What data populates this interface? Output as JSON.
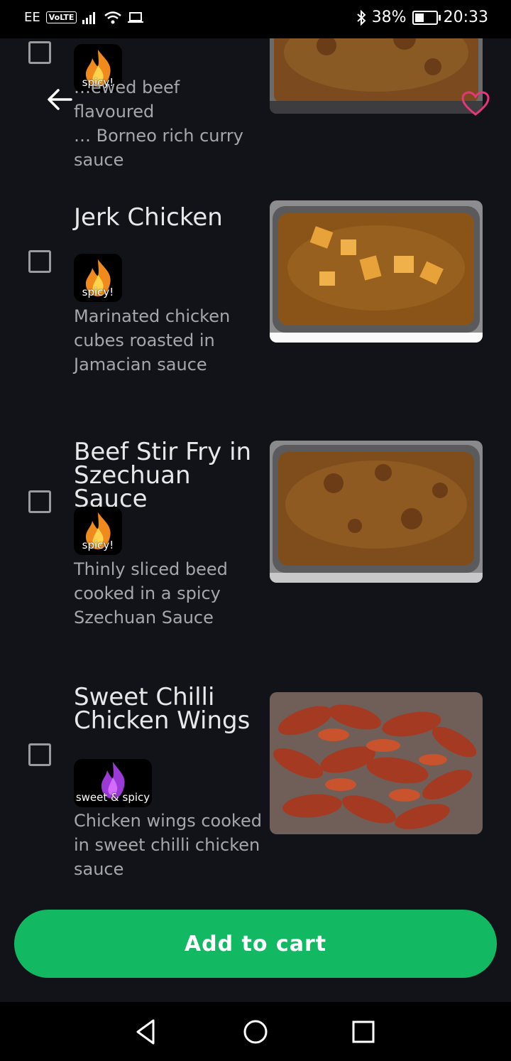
{
  "status_bar": {
    "carrier": "EE",
    "volte": "VoLTE",
    "battery": "38%",
    "time": "20:33"
  },
  "items": [
    {
      "name": "",
      "badge": "spicy!",
      "description": "…tewed beef flavoured …n Borneo rich curry sauce",
      "desc_lines": [
        "…ewed beef flavoured",
        "… Borneo rich curry",
        "sauce"
      ]
    },
    {
      "name": "Jerk Chicken",
      "badge": "spicy!",
      "desc_lines": [
        "Marinated chicken",
        "cubes roasted in",
        "Jamacian sauce"
      ]
    },
    {
      "name_lines": [
        "Beef Stir Fry in",
        "Szechuan Sauce"
      ],
      "badge": "spicy!",
      "desc_lines": [
        "Thinly sliced beed",
        "cooked in a spicy",
        "Szechuan Sauce"
      ]
    },
    {
      "name_lines": [
        "Sweet Chilli",
        "Chicken Wings"
      ],
      "badge": "sweet & spicy",
      "desc_lines": [
        "Chicken wings cooked",
        "in sweet chilli chicken",
        "sauce"
      ]
    }
  ],
  "cart_button": {
    "label": "Add to cart"
  },
  "colors": {
    "background": "#121318",
    "accent_green": "#13b962",
    "heart_pink": "#e8367a"
  },
  "icons": [
    "back-arrow-icon",
    "heart-icon",
    "spicy-flame-icon",
    "sweet-spicy-flame-icon",
    "nav-back-icon",
    "nav-home-icon",
    "nav-recents-icon"
  ]
}
